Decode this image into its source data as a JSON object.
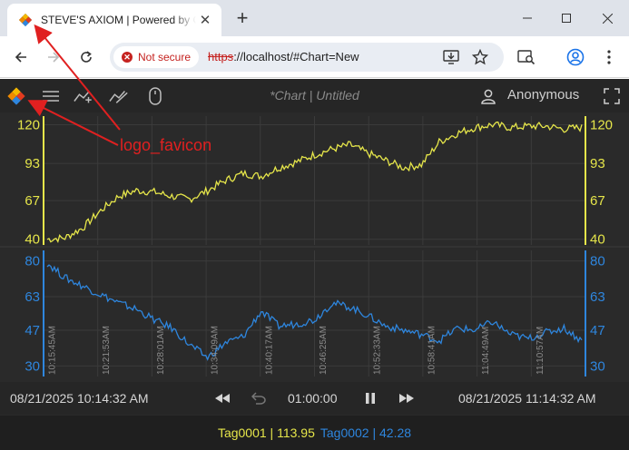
{
  "browser": {
    "tab_title": "STEVE'S AXIOM | Powered by Canary",
    "security_label": "Not secure",
    "url_scheme": "https",
    "url_rest": "://localhost/#Chart=New"
  },
  "app": {
    "chart_title": "*Chart | Untitled",
    "user_name": "Anonymous",
    "start_time": "08/21/2025  10:14:32 AM",
    "end_time": "08/21/2025  11:14:32 AM",
    "duration": "01:00:00",
    "colors": {
      "tag1": "#e6e64a",
      "tag2": "#2e86de",
      "background": "#2a2a2a"
    },
    "legend": [
      {
        "label": "Tag0001 | 113.95"
      },
      {
        "label": "Tag0002 | 42.28"
      }
    ]
  },
  "annotation": {
    "label": "logo_favicon",
    "color": "#e02020"
  },
  "chart_data": [
    {
      "type": "line",
      "title": "",
      "series": [
        {
          "name": "Tag0001",
          "x": [
            0,
            2,
            4,
            6,
            8,
            10,
            12,
            14,
            16,
            18,
            20,
            22,
            24,
            26,
            28,
            30,
            32,
            34,
            36,
            38,
            40,
            42,
            44,
            46,
            48,
            50,
            52,
            54,
            56,
            58,
            60
          ],
          "values": [
            40,
            41,
            48,
            60,
            70,
            74,
            73,
            70,
            68,
            74,
            81,
            86,
            84,
            90,
            94,
            99,
            103,
            106,
            100,
            95,
            90,
            92,
            108,
            114,
            118,
            120,
            118,
            119,
            119,
            117,
            118
          ]
        }
      ],
      "yticks": [
        40,
        67,
        93,
        120
      ],
      "ylim": [
        36,
        126
      ]
    },
    {
      "type": "line",
      "title": "",
      "series": [
        {
          "name": "Tag0002",
          "x": [
            0,
            2,
            4,
            6,
            8,
            10,
            12,
            14,
            16,
            18,
            20,
            22,
            24,
            26,
            28,
            30,
            32,
            34,
            36,
            38,
            40,
            42,
            44,
            46,
            48,
            50,
            52,
            54,
            56,
            58,
            60
          ],
          "values": [
            79,
            72,
            68,
            64,
            60,
            57,
            52,
            48,
            40,
            34,
            41,
            44,
            56,
            49,
            50,
            52,
            60,
            58,
            54,
            49,
            47,
            45,
            42,
            48,
            47,
            51,
            45,
            43,
            46,
            48,
            42
          ],
          "time_labels": [
            "10:15:45AM",
            "10:21:53AM",
            "10:28:01AM",
            "10:34:09AM",
            "10:40:17AM",
            "10:46:25AM",
            "10:52:33AM",
            "10:58:41AM",
            "11:04:49AM",
            "11:10:57AM"
          ]
        }
      ],
      "yticks": [
        30,
        47,
        63,
        80
      ],
      "ylim": [
        25,
        85
      ]
    }
  ]
}
